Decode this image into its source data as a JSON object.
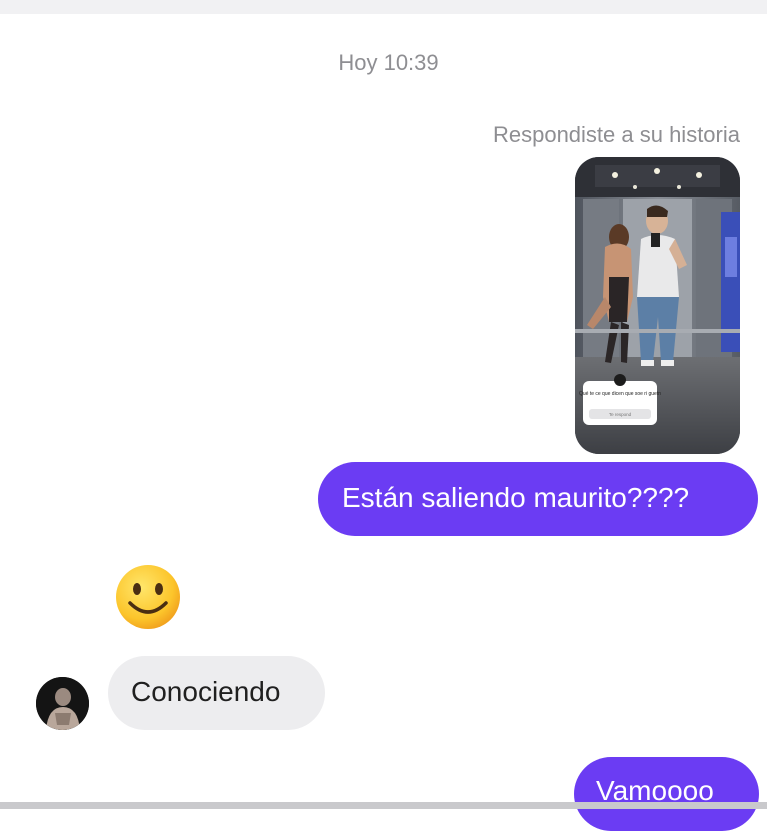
{
  "chat": {
    "timestamp": "Hoy 10:39",
    "story_reply_label": "Respondiste a su historia",
    "story_sticker": {
      "question": "Qué te ce que dicen que soe ri guetn",
      "reply_placeholder": "Te respond"
    }
  },
  "messages": {
    "outgoing_1": "Están saliendo maurito????",
    "reaction_emoji": "smiling-face",
    "incoming_1": "Conociendo",
    "outgoing_2": "Vamoooo"
  },
  "colors": {
    "outgoing_bubble": "#6b3cf3",
    "incoming_bubble": "#ededef",
    "meta_text": "#8e8e92"
  }
}
